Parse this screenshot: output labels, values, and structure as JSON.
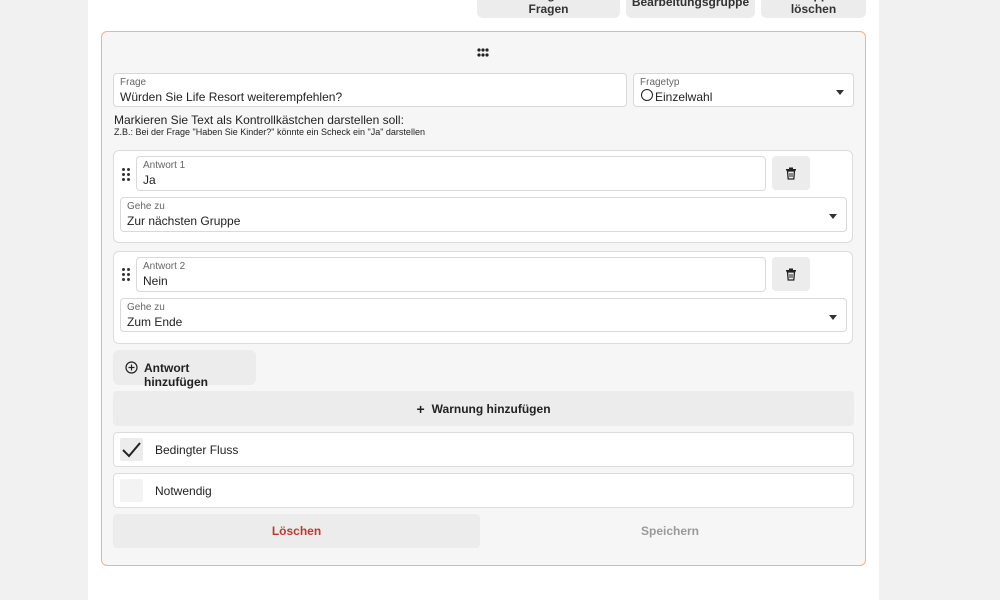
{
  "top_buttons": {
    "add_questions": "Hinzufügen von Fragen",
    "edit_group": "Bearbeitungsgruppe",
    "delete_group": "Gruppe löschen"
  },
  "question": {
    "label": "Frage",
    "value": "Würden Sie Life Resort weiterempfehlen?"
  },
  "question_type": {
    "label": "Fragetyp",
    "value": "Einzelwahl",
    "icon": "radio-circle-icon"
  },
  "hint": {
    "title": "Markieren Sie Text als Kontrollkästchen darstellen soll:",
    "example": "Z.B.: Bei der Frage \"Haben Sie Kinder?\" könnte ein Scheck ein \"Ja\" darstellen"
  },
  "answers": [
    {
      "label": "Antwort 1",
      "value": "Ja",
      "goto_label": "Gehe zu",
      "goto_value": "Zur nächsten Gruppe"
    },
    {
      "label": "Antwort 2",
      "value": "Nein",
      "goto_label": "Gehe zu",
      "goto_value": "Zum Ende"
    }
  ],
  "add_answer_label": "Antwort hinzufügen",
  "add_warning_label": "Warnung hinzufügen",
  "options": [
    {
      "label": "Bedingter Fluss",
      "checked": true
    },
    {
      "label": "Notwendig",
      "checked": false
    }
  ],
  "footer": {
    "delete_label": "Löschen",
    "save_label": "Speichern"
  },
  "colors": {
    "accent_border": "#f0b38a",
    "delete_text": "#c0392b",
    "disabled_text": "#9a9a9a"
  }
}
